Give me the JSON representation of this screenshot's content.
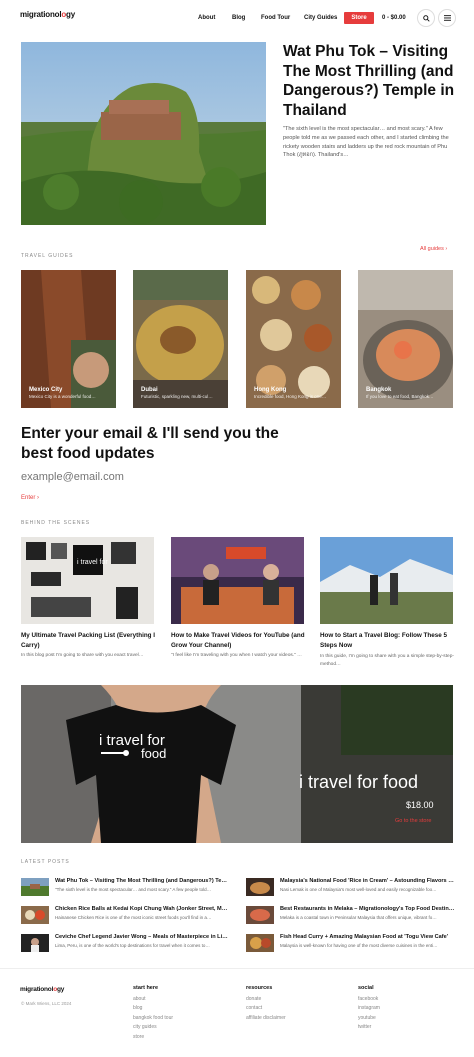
{
  "header": {
    "logo": {
      "part1": "migrationol",
      "part2": "o",
      "part3": "gy"
    },
    "nav": [
      "About",
      "Blog",
      "Food Tour",
      "City Guides"
    ],
    "store_label": "Store",
    "cart_label": "0 - $0.00",
    "search_icon": "search-icon",
    "menu_icon": "menu-icon"
  },
  "hero": {
    "title": "Wat Phu Tok – Visiting The Most Thrilling (and Dangerous?) Temple in Thailand",
    "excerpt": "\"The sixth level is the most spectacular… and most scary.\" A few people told me as we passed each other, and I started climbing the rickety wooden stairs and ladders up the red rock mountain of Phu Thok (ภูทอก). Thailand's…"
  },
  "guides": {
    "label": "TRAVEL GUIDES",
    "all_label": "All guides",
    "items": [
      {
        "title": "Mexico City",
        "desc": "Mexico City is a wonderful food…"
      },
      {
        "title": "Dubai",
        "desc": "Futuristic, sparkling new, multi-cul…"
      },
      {
        "title": "Hong Kong",
        "desc": "Incredible food, Hong Kong is one…"
      },
      {
        "title": "Bangkok",
        "desc": "If you love to eat food, Bangkok…"
      }
    ]
  },
  "newsletter": {
    "heading": "Enter your email & I'll send you the best food updates",
    "placeholder": "example@email.com",
    "enter_label": "Enter"
  },
  "behind": {
    "label": "BEHIND THE SCENES",
    "items": [
      {
        "title": "My Ultimate Travel Packing List (Everything I Carry)",
        "excerpt": "In this blog post I'm going to share with you exact travel…"
      },
      {
        "title": "How to Make Travel Videos for YouTube (and Grow Your Channel)",
        "excerpt": "\"I feel like I'm traveling with you when I watch your videos.\" …"
      },
      {
        "title": "How to Start a Travel Blog: Follow These 5 Steps Now",
        "excerpt": "In this guide, I'm going to share with you a simple step-by-step-method…"
      }
    ]
  },
  "banner": {
    "shirt_text_1": "i travel for",
    "shirt_text_2": "food",
    "title": "i travel for food",
    "price": "$18.00",
    "link": "Go to the store"
  },
  "latest": {
    "label": "LATEST POSTS",
    "items": [
      {
        "title": "Wat Phu Tok – Visiting The Most Thrilling (and Dangerous?) Te…",
        "excerpt": "\"The sixth level is the most spectacular… and most scary.\" A few people told…"
      },
      {
        "title": "Malaysia's National Food 'Rice in Cream' – Astounding Flavors …",
        "excerpt": "Nasi Lemak is one of Malaysia's most well-loved and easily recognizable foo…"
      },
      {
        "title": "Chicken Rice Balls at Kedai Kopi Chung Wah (Jonker Street, M…",
        "excerpt": "Hainanese Chicken Rice is one of the most iconic street foods you'll find in a…"
      },
      {
        "title": "Best Restaurants in Melaka – Migrationology's Top Food Destin…",
        "excerpt": "Melaka is a coastal town in Peninsular Malaysia that offers unique, vibrant fo…"
      },
      {
        "title": "Ceviche Chef Legend Javier Wong – Meals of Masterpiece in Li…",
        "excerpt": "Lima, Peru, is one of the world's top destinations for travel when it comes to…"
      },
      {
        "title": "Fish Head Curry + Amazing Malaysian Food at 'Togu View Cafe'",
        "excerpt": "Malaysia is well-known for having one of the most diverse cuisines in the enti…"
      }
    ]
  },
  "footer": {
    "copyright": "© Mark Wiens, LLC 2024",
    "columns": [
      {
        "heading": "start here",
        "links": [
          "about",
          "blog",
          "bangkok food tour",
          "city guides",
          "store"
        ]
      },
      {
        "heading": "resources",
        "links": [
          "donate",
          "contact",
          "affiliate disclaimer"
        ]
      },
      {
        "heading": "social",
        "links": [
          "facebook",
          "instagram",
          "youtube",
          "twitter"
        ]
      }
    ]
  },
  "colors": {
    "accent": "#e63c3c"
  }
}
